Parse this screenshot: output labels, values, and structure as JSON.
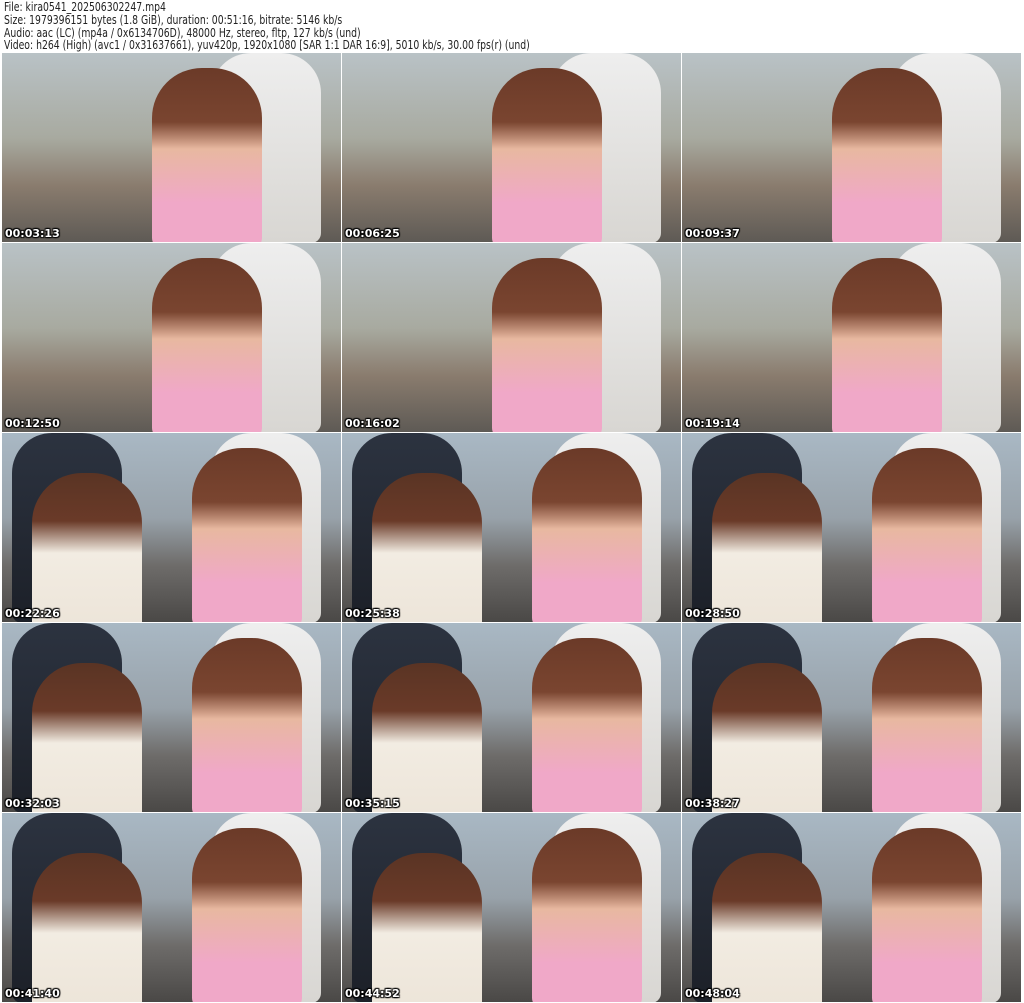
{
  "header": {
    "file": "File: kira0541_202506302247.mp4",
    "size": "Size: 1979396151 bytes (1.8 GiB), duration: 00:51:16, bitrate: 5146 kb/s",
    "audio": "Audio: aac (LC) (mp4a / 0x6134706D), 48000 Hz, stereo, fltp, 127 kb/s (und)",
    "video": "Video: h264 (High) (avc1 / 0x31637661), yuv420p, 1920x1080 [SAR 1:1 DAR 16:9], 5010 kb/s, 30.00 fps(r) (und)"
  },
  "thumbnails": [
    {
      "timestamp": "00:03:13",
      "scene": "solo"
    },
    {
      "timestamp": "00:06:25",
      "scene": "solo"
    },
    {
      "timestamp": "00:09:37",
      "scene": "solo"
    },
    {
      "timestamp": "00:12:50",
      "scene": "solo"
    },
    {
      "timestamp": "00:16:02",
      "scene": "solo"
    },
    {
      "timestamp": "00:19:14",
      "scene": "solo"
    },
    {
      "timestamp": "00:22:26",
      "scene": "duo"
    },
    {
      "timestamp": "00:25:38",
      "scene": "duo"
    },
    {
      "timestamp": "00:28:50",
      "scene": "duo"
    },
    {
      "timestamp": "00:32:03",
      "scene": "duo"
    },
    {
      "timestamp": "00:35:15",
      "scene": "duo"
    },
    {
      "timestamp": "00:38:27",
      "scene": "duo"
    },
    {
      "timestamp": "00:41:40",
      "scene": "duo"
    },
    {
      "timestamp": "00:44:52",
      "scene": "duo"
    },
    {
      "timestamp": "00:48:04",
      "scene": "duo"
    }
  ]
}
